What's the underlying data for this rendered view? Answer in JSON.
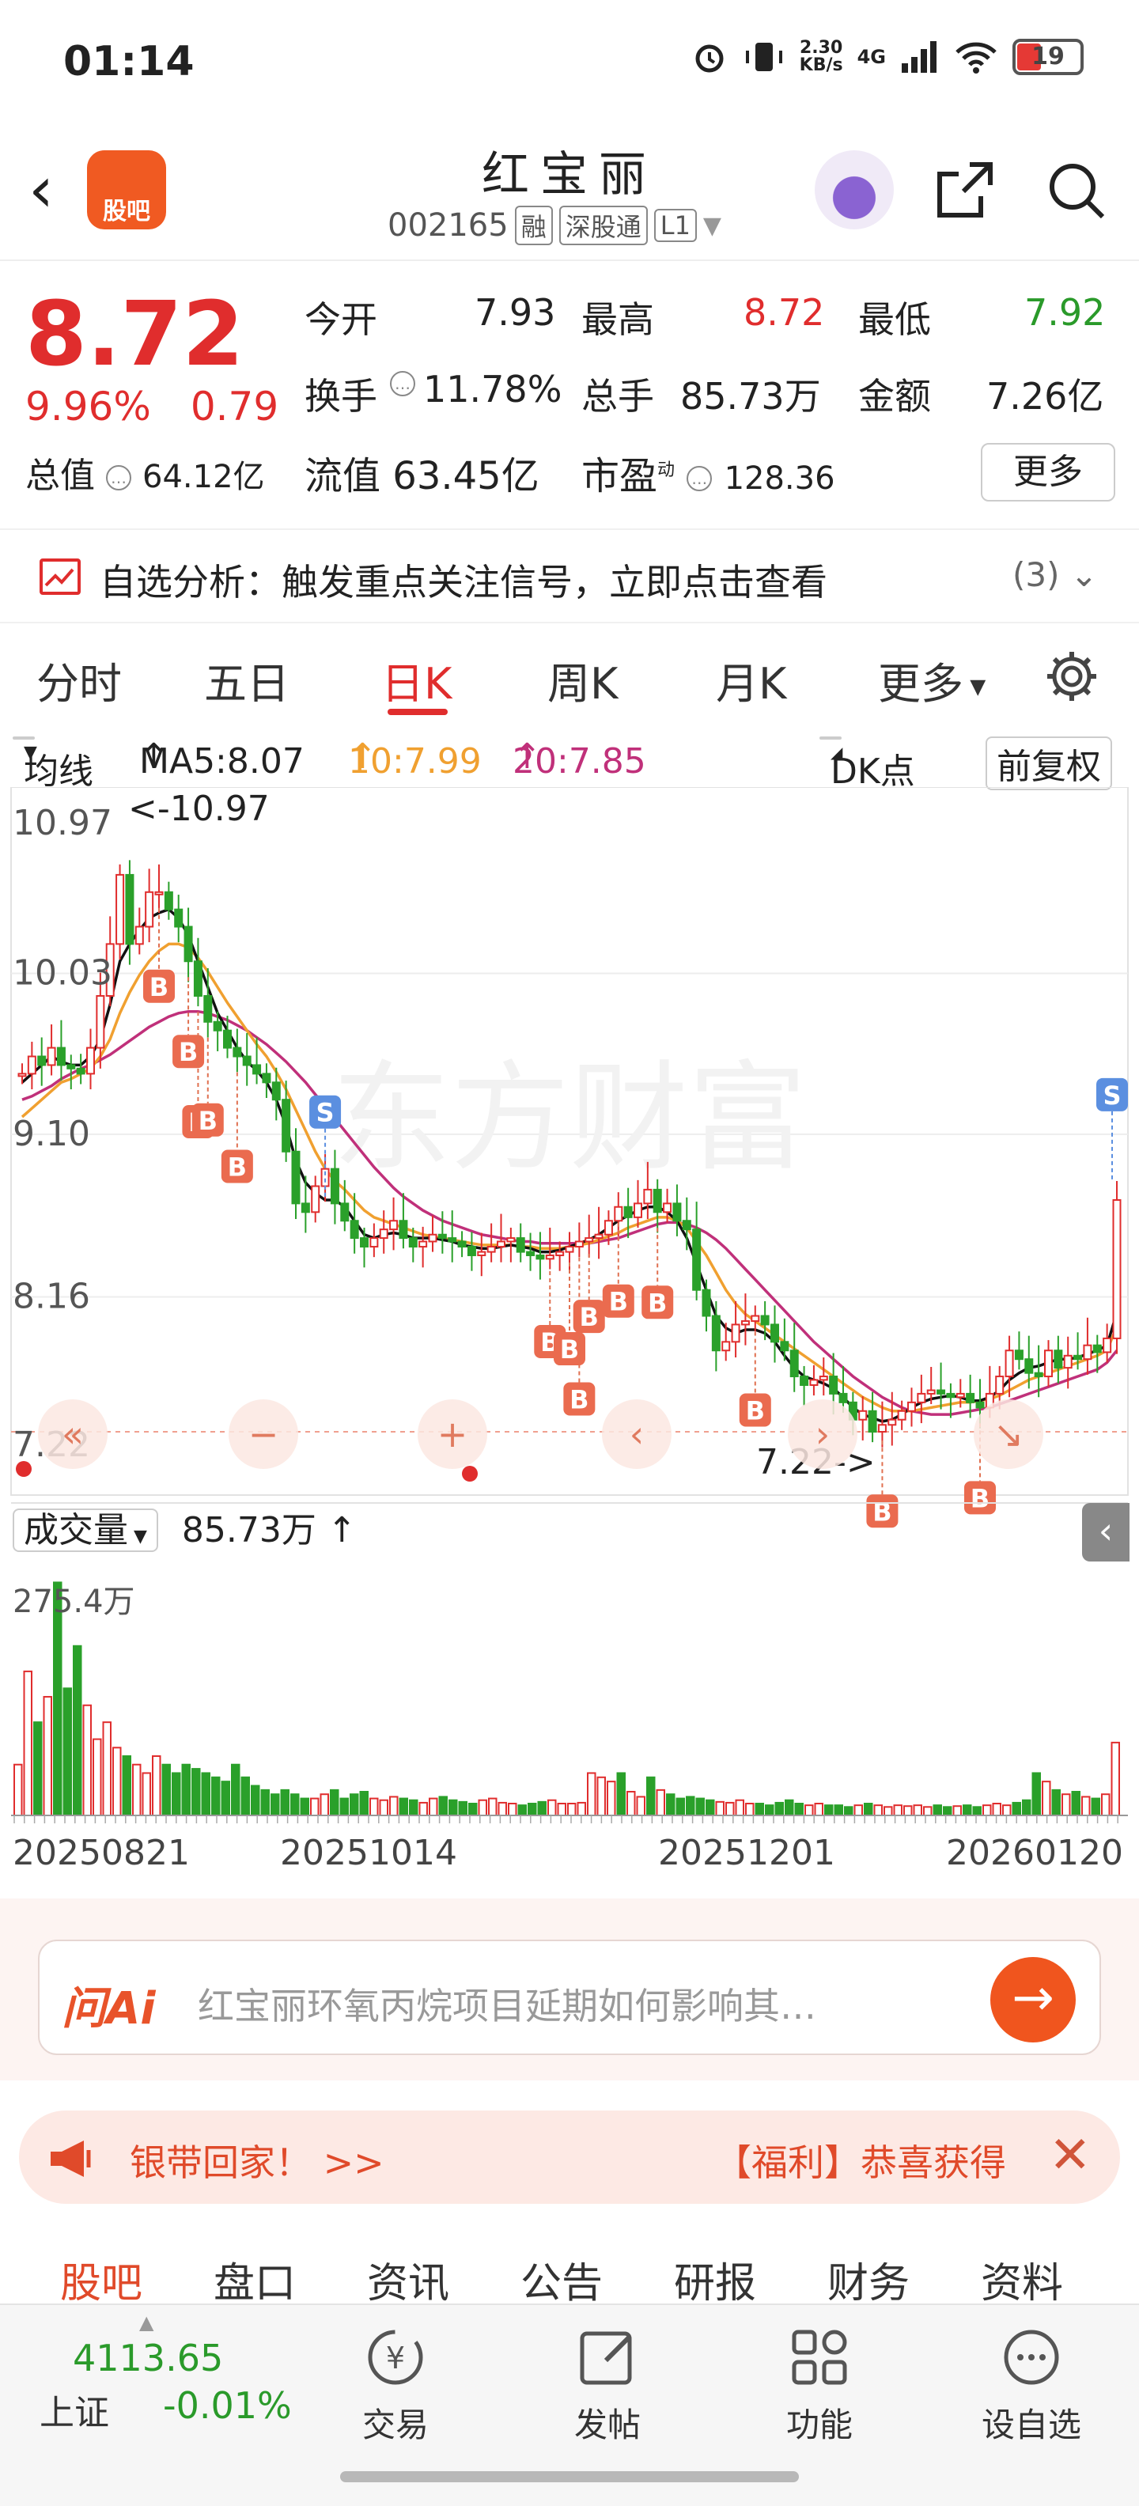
{
  "status_bar": {
    "time": "01:14",
    "net_speed_top": "2.30",
    "net_speed_bottom": "KB/s",
    "network": "4G",
    "battery": "19"
  },
  "header": {
    "app_badge": "股吧",
    "stock_name": "红宝丽",
    "stock_code": "002165",
    "tags": [
      "融",
      "深股通",
      "L1"
    ]
  },
  "quote": {
    "price": "8.72",
    "change_pct": "9.96%",
    "change": "0.79",
    "open_label": "今开",
    "open": "7.93",
    "high_label": "最高",
    "high": "8.72",
    "low_label": "最低",
    "low": "7.92",
    "turnover_label": "换手",
    "turnover": "11.78%",
    "volume_label": "总手",
    "volume": "85.73万",
    "amount_label": "金额",
    "amount": "7.26亿",
    "mktcap_label": "总值",
    "mktcap": "64.12亿",
    "float_label": "流值",
    "float_cap": "63.45亿",
    "pe_label": "市盈",
    "pe_sup": "动",
    "pe": "128.36",
    "more_button": "更多"
  },
  "analysis": {
    "text": "自选分析：触发重点关注信号，立即点击查看",
    "count": "(3)"
  },
  "period_tabs": [
    "分时",
    "五日",
    "日K",
    "周K",
    "月K",
    "更多"
  ],
  "active_period": "日K",
  "ma": {
    "select": "均线",
    "ma5": "MA5:8.07",
    "ma10": "10:7.99",
    "ma20": "20:7.85",
    "dk": "DK点",
    "adjust": "前复权"
  },
  "chart_data": {
    "type": "candlestick",
    "y_axis_labels": [
      "10.97",
      "10.03",
      "9.10",
      "8.16",
      "7.22"
    ],
    "high_marker": "<-10.97",
    "low_marker": "7.22->",
    "ylim": [
      7.22,
      10.97
    ],
    "colors": {
      "up": "#e02d2d",
      "down": "#2aa02a",
      "ma5": "#111111",
      "ma10": "#f0a030",
      "ma20": "#c0307a"
    },
    "closes": [
      9.45,
      9.55,
      9.5,
      9.6,
      9.5,
      9.48,
      9.45,
      9.6,
      9.9,
      10.2,
      10.6,
      10.2,
      10.3,
      10.5,
      10.5,
      10.4,
      10.3,
      10.1,
      9.9,
      9.75,
      9.7,
      9.6,
      9.55,
      9.5,
      9.45,
      9.4,
      9.3,
      9.0,
      8.7,
      8.65,
      8.8,
      8.9,
      8.7,
      8.6,
      8.5,
      8.45,
      8.5,
      8.55,
      8.6,
      8.5,
      8.45,
      8.48,
      8.52,
      8.5,
      8.48,
      8.45,
      8.4,
      8.42,
      8.45,
      8.48,
      8.5,
      8.42,
      8.4,
      8.38,
      8.4,
      8.42,
      8.45,
      8.48,
      8.5,
      8.52,
      8.6,
      8.68,
      8.62,
      8.7,
      8.78,
      8.65,
      8.7,
      8.6,
      8.55,
      8.2,
      8.05,
      7.85,
      7.9,
      8.0,
      8.02,
      8.05,
      8.0,
      7.9,
      7.85,
      7.7,
      7.65,
      7.68,
      7.7,
      7.6,
      7.55,
      7.45,
      7.5,
      7.38,
      7.42,
      7.45,
      7.5,
      7.55,
      7.6,
      7.62,
      7.6,
      7.58,
      7.6,
      7.55,
      7.52,
      7.6,
      7.7,
      7.85,
      7.8,
      7.72,
      7.7,
      7.85,
      7.75,
      7.82,
      7.8,
      7.88,
      7.84,
      7.92,
      8.72
    ],
    "ma5": [
      9.4,
      9.45,
      9.5,
      9.55,
      9.52,
      9.5,
      9.5,
      9.55,
      9.65,
      9.85,
      10.1,
      10.2,
      10.28,
      10.35,
      10.38,
      10.4,
      10.35,
      10.25,
      10.1,
      9.95,
      9.8,
      9.7,
      9.6,
      9.52,
      9.47,
      9.4,
      9.3,
      9.15,
      8.95,
      8.82,
      8.76,
      8.72,
      8.72,
      8.68,
      8.6,
      8.52,
      8.5,
      8.52,
      8.53,
      8.52,
      8.5,
      8.5,
      8.5,
      8.49,
      8.48,
      8.46,
      8.45,
      8.44,
      8.44,
      8.45,
      8.46,
      8.45,
      8.44,
      8.42,
      8.42,
      8.43,
      8.45,
      8.47,
      8.49,
      8.52,
      8.56,
      8.6,
      8.63,
      8.66,
      8.68,
      8.68,
      8.65,
      8.6,
      8.5,
      8.35,
      8.2,
      8.05,
      7.98,
      7.95,
      7.97,
      7.97,
      7.95,
      7.9,
      7.82,
      7.75,
      7.7,
      7.68,
      7.66,
      7.63,
      7.58,
      7.52,
      7.48,
      7.46,
      7.44,
      7.45,
      7.48,
      7.52,
      7.55,
      7.57,
      7.58,
      7.59,
      7.58,
      7.56,
      7.56,
      7.58,
      7.62,
      7.68,
      7.72,
      7.75,
      7.76,
      7.78,
      7.8,
      7.8,
      7.81,
      7.83,
      7.85,
      7.88,
      8.07
    ],
    "ma10": [
      9.2,
      9.25,
      9.3,
      9.35,
      9.4,
      9.42,
      9.45,
      9.48,
      9.55,
      9.65,
      9.8,
      9.92,
      10.02,
      10.1,
      10.16,
      10.2,
      10.2,
      10.18,
      10.12,
      10.04,
      9.95,
      9.86,
      9.78,
      9.7,
      9.62,
      9.55,
      9.46,
      9.36,
      9.24,
      9.12,
      9.0,
      8.9,
      8.83,
      8.78,
      8.72,
      8.66,
      8.62,
      8.6,
      8.58,
      8.56,
      8.54,
      8.52,
      8.51,
      8.5,
      8.49,
      8.48,
      8.47,
      8.46,
      8.46,
      8.46,
      8.46,
      8.45,
      8.45,
      8.44,
      8.44,
      8.44,
      8.45,
      8.46,
      8.47,
      8.49,
      8.51,
      8.53,
      8.56,
      8.58,
      8.6,
      8.62,
      8.62,
      8.6,
      8.56,
      8.48,
      8.4,
      8.3,
      8.2,
      8.12,
      8.06,
      8.02,
      7.98,
      7.94,
      7.9,
      7.86,
      7.82,
      7.78,
      7.74,
      7.7,
      7.66,
      7.62,
      7.58,
      7.55,
      7.52,
      7.5,
      7.5,
      7.5,
      7.51,
      7.52,
      7.53,
      7.54,
      7.55,
      7.55,
      7.56,
      7.57,
      7.59,
      7.62,
      7.65,
      7.68,
      7.7,
      7.72,
      7.74,
      7.76,
      7.78,
      7.8,
      7.82,
      7.85,
      7.99
    ],
    "ma20": [
      9.3,
      9.32,
      9.35,
      9.38,
      9.42,
      9.45,
      9.48,
      9.5,
      9.53,
      9.56,
      9.6,
      9.64,
      9.68,
      9.72,
      9.75,
      9.78,
      9.8,
      9.81,
      9.81,
      9.8,
      9.78,
      9.76,
      9.73,
      9.7,
      9.66,
      9.62,
      9.57,
      9.52,
      9.46,
      9.4,
      9.33,
      9.26,
      9.19,
      9.12,
      9.05,
      8.98,
      8.91,
      8.85,
      8.79,
      8.74,
      8.7,
      8.66,
      8.63,
      8.6,
      8.58,
      8.56,
      8.54,
      8.52,
      8.51,
      8.5,
      8.49,
      8.48,
      8.48,
      8.47,
      8.47,
      8.47,
      8.47,
      8.47,
      8.47,
      8.48,
      8.49,
      8.5,
      8.52,
      8.54,
      8.56,
      8.58,
      8.59,
      8.59,
      8.58,
      8.56,
      8.53,
      8.49,
      8.44,
      8.38,
      8.32,
      8.26,
      8.2,
      8.14,
      8.08,
      8.02,
      7.96,
      7.9,
      7.85,
      7.8,
      7.75,
      7.7,
      7.66,
      7.62,
      7.58,
      7.55,
      7.52,
      7.5,
      7.49,
      7.48,
      7.48,
      7.48,
      7.49,
      7.5,
      7.51,
      7.52,
      7.54,
      7.56,
      7.58,
      7.6,
      7.62,
      7.64,
      7.66,
      7.68,
      7.7,
      7.72,
      7.74,
      7.78,
      7.85
    ],
    "volume_label": "成交量",
    "volume_value": "85.73万",
    "volume_max_label": "275.4万",
    "volume_ylim": [
      0,
      275.4
    ],
    "volumes": [
      60,
      170,
      110,
      140,
      275,
      150,
      200,
      130,
      90,
      110,
      80,
      70,
      60,
      50,
      70,
      60,
      50,
      60,
      55,
      50,
      45,
      40,
      60,
      45,
      35,
      30,
      25,
      30,
      25,
      20,
      20,
      25,
      30,
      20,
      25,
      28,
      20,
      18,
      22,
      20,
      18,
      15,
      20,
      22,
      18,
      16,
      14,
      18,
      20,
      15,
      14,
      12,
      14,
      16,
      18,
      14,
      14,
      15,
      50,
      45,
      40,
      50,
      28,
      22,
      45,
      30,
      25,
      20,
      22,
      20,
      18,
      16,
      15,
      18,
      14,
      14,
      12,
      15,
      18,
      14,
      12,
      14,
      12,
      12,
      10,
      12,
      14,
      12,
      10,
      12,
      11,
      12,
      10,
      12,
      10,
      11,
      12,
      10,
      12,
      14,
      12,
      15,
      18,
      50,
      40,
      30,
      25,
      28,
      22,
      20,
      25,
      86
    ],
    "x_ticks": [
      "20250821",
      "20251014",
      "20251201",
      "20260120"
    ],
    "buy_marks": [
      "B",
      "B",
      "B",
      "B",
      "B",
      "B",
      "B",
      "B",
      "B",
      "B",
      "B",
      "B",
      "B",
      "B"
    ],
    "sell_marks": [
      "S",
      "S"
    ],
    "watermark": "东方财富"
  },
  "ask_ai": {
    "logo": "问Ai",
    "question": "红宝丽环氧丙烷项目延期如何影响其…",
    "go": "→"
  },
  "banner": {
    "left_text": "银带回家！ >>",
    "right_text": "【福利】恭喜获得"
  },
  "bottom_tabs": [
    "股吧",
    "盘口",
    "资讯",
    "公告",
    "研报",
    "财务",
    "资料"
  ],
  "index": {
    "value": "4113.65",
    "name": "上证",
    "change": "-0.01%"
  },
  "bottom_nav": [
    "交易",
    "发帖",
    "功能",
    "设自选"
  ]
}
